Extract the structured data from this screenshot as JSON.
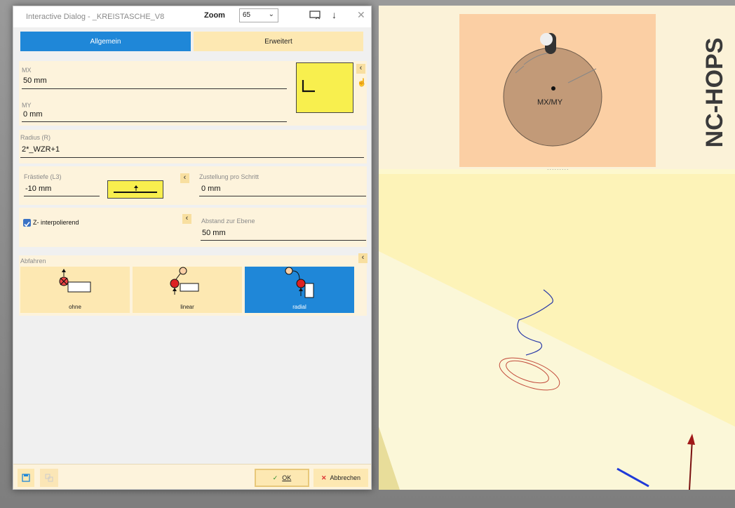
{
  "window": {
    "title": "Interactive Dialog - _KREISTASCHE_V8",
    "zoom_label": "Zoom",
    "zoom_value": "65"
  },
  "tabs": [
    {
      "label": "Allgemein",
      "active": true
    },
    {
      "label": "Erweitert",
      "active": false
    }
  ],
  "position": {
    "mx_label": "MX",
    "mx_value": "50 mm",
    "my_label": "MY",
    "my_value": "0 mm"
  },
  "radius": {
    "label": "Radius (R)",
    "value": "2*_WZR+1"
  },
  "depth": {
    "label": "Frästiefe (L3)",
    "value": "-10 mm",
    "step_label": "Zustellung pro Schritt",
    "step_value": "0 mm"
  },
  "z_interp": {
    "checkbox_label": "Z- interpolierend",
    "checked": true,
    "distance_label": "Abstand zur Ebene",
    "distance_value": "50 mm"
  },
  "retract": {
    "label": "Abfahren",
    "options": [
      {
        "label": "ohne",
        "selected": false
      },
      {
        "label": "linear",
        "selected": false
      },
      {
        "label": "radial",
        "selected": true
      }
    ]
  },
  "footer": {
    "ok_label": "OK",
    "cancel_label": "Abbrechen"
  },
  "preview": {
    "center_label": "MX/MY",
    "brand": "NC-HOPS"
  },
  "colors": {
    "accent": "#1f87d8",
    "panel": "#fdf3dc",
    "field_yellow": "#f8ef4e",
    "tab_inactive": "#fde8b2"
  }
}
